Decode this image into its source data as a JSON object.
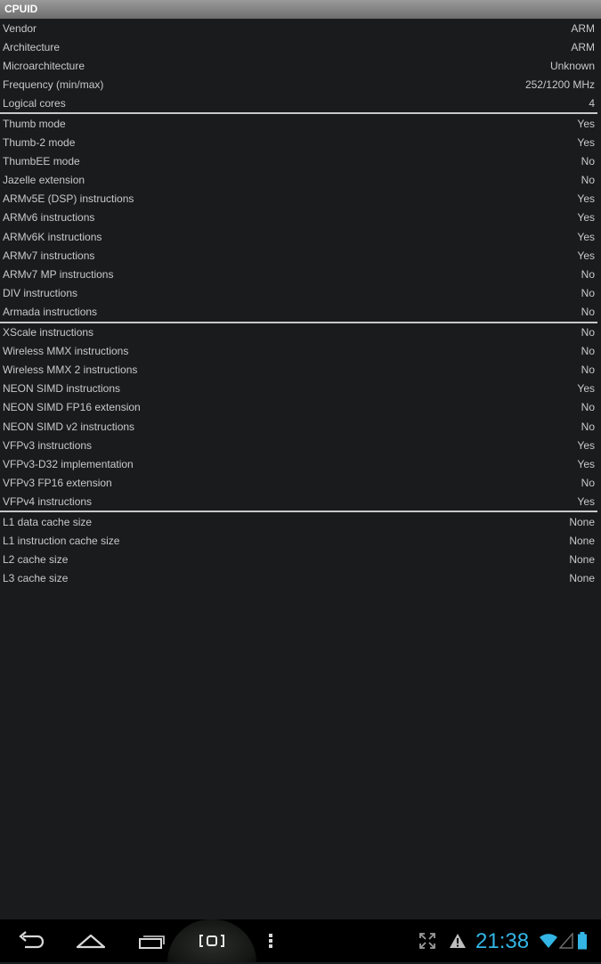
{
  "app": {
    "title": "CPUID"
  },
  "sections": [
    [
      {
        "label": "Vendor",
        "value": "ARM"
      },
      {
        "label": "Architecture",
        "value": "ARM"
      },
      {
        "label": "Microarchitecture",
        "value": "Unknown"
      },
      {
        "label": "Frequency (min/max)",
        "value": "252/1200 MHz"
      },
      {
        "label": "Logical cores",
        "value": "4"
      }
    ],
    [
      {
        "label": "Thumb mode",
        "value": "Yes"
      },
      {
        "label": "Thumb-2 mode",
        "value": "Yes"
      },
      {
        "label": "ThumbEE mode",
        "value": "No"
      },
      {
        "label": "Jazelle extension",
        "value": "No"
      },
      {
        "label": "ARMv5E (DSP) instructions",
        "value": "Yes"
      },
      {
        "label": "ARMv6 instructions",
        "value": "Yes"
      },
      {
        "label": "ARMv6K instructions",
        "value": "Yes"
      },
      {
        "label": "ARMv7 instructions",
        "value": "Yes"
      },
      {
        "label": "ARMv7 MP instructions",
        "value": "No"
      },
      {
        "label": "DIV instructions",
        "value": "No"
      },
      {
        "label": "Armada instructions",
        "value": "No"
      }
    ],
    [
      {
        "label": "XScale instructions",
        "value": "No"
      },
      {
        "label": "Wireless MMX instructions",
        "value": "No"
      },
      {
        "label": "Wireless MMX 2 instructions",
        "value": "No"
      },
      {
        "label": "NEON SIMD instructions",
        "value": "Yes"
      },
      {
        "label": "NEON SIMD FP16 extension",
        "value": "No"
      },
      {
        "label": "NEON SIMD v2 instructions",
        "value": "No"
      },
      {
        "label": "VFPv3 instructions",
        "value": "Yes"
      },
      {
        "label": "VFPv3-D32 implementation",
        "value": "Yes"
      },
      {
        "label": "VFPv3 FP16 extension",
        "value": "No"
      },
      {
        "label": "VFPv4 instructions",
        "value": "Yes"
      }
    ],
    [
      {
        "label": "L1 data cache size",
        "value": "None"
      },
      {
        "label": "L1 instruction cache size",
        "value": "None"
      },
      {
        "label": "L2 cache size",
        "value": "None"
      },
      {
        "label": "L3 cache size",
        "value": "None"
      }
    ]
  ],
  "navbar": {
    "buttons": [
      "back-icon",
      "home-icon",
      "recent-apps-icon",
      "screenshot-icon",
      "menu-icon"
    ]
  },
  "status": {
    "clock": "21:38",
    "icons": [
      "expand-icon",
      "warning-icon",
      "wifi-icon",
      "signal-icon",
      "battery-icon"
    ],
    "accent": "#33b5e5"
  }
}
